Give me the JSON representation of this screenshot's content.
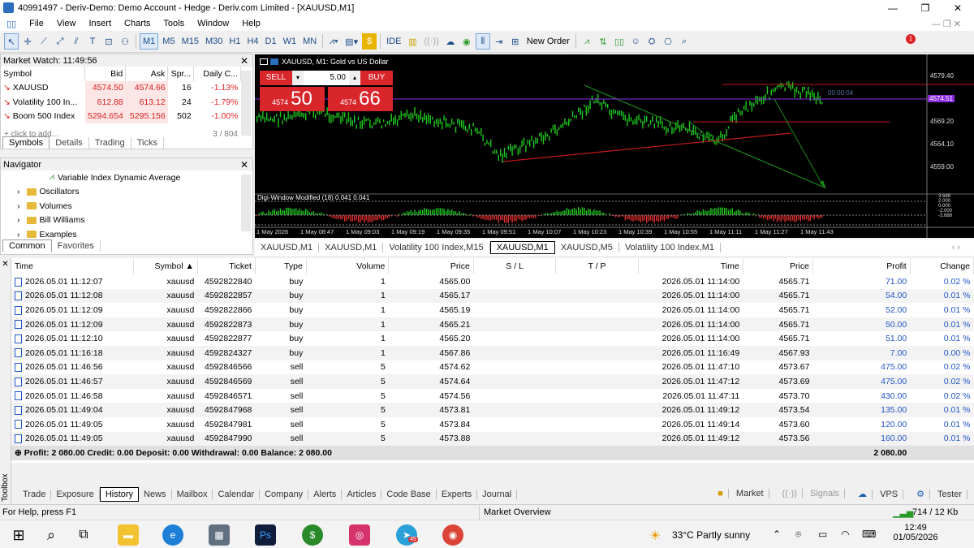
{
  "window": {
    "title": "40991497 - Deriv-Demo: Demo Account - Hedge - Deriv.com Limited - [XAUUSD,M1]"
  },
  "menu": [
    "File",
    "View",
    "Insert",
    "Charts",
    "Tools",
    "Window",
    "Help"
  ],
  "toolbar": {
    "timeframes": [
      "M1",
      "M5",
      "M15",
      "M30",
      "H1",
      "H4",
      "D1",
      "W1",
      "MN"
    ],
    "ide": "IDE",
    "new_order": "New Order",
    "notif_count": "1"
  },
  "market_watch": {
    "title": "Market Watch: 11:49:56",
    "headers": [
      "Symbol",
      "Bid",
      "Ask",
      "Spr...",
      "Daily C..."
    ],
    "rows": [
      {
        "symbol": "XAUUSD",
        "bid": "4574.50",
        "ask": "4574.66",
        "spread": "16",
        "change": "-1.13%"
      },
      {
        "symbol": "Volatility 100 In...",
        "bid": "612.88",
        "ask": "613.12",
        "spread": "24",
        "change": "-1.79%"
      },
      {
        "symbol": "Boom 500 Index",
        "bid": "5294.654",
        "ask": "5295.156",
        "spread": "502",
        "change": "-1.00%"
      }
    ],
    "add_text": "click to add...",
    "count": "3 / 804",
    "tabs": [
      "Symbols",
      "Details",
      "Trading",
      "Ticks"
    ]
  },
  "navigator": {
    "title": "Navigator",
    "items": [
      "Variable Index Dynamic Average",
      "Oscillators",
      "Volumes",
      "Bill Williams",
      "Examples"
    ],
    "tabs": [
      "Common",
      "Favorites"
    ]
  },
  "chart": {
    "header": "XAUUSD, M1:  Gold vs US Dollar",
    "sell": "SELL",
    "buy": "BUY",
    "lot": "5.00",
    "sell_small": "4574",
    "sell_big": "50",
    "buy_small": "4574",
    "buy_big": "66",
    "prices": [
      "4579.40",
      "4574.51",
      "4569.20",
      "4564.10",
      "4559.00"
    ],
    "timer": "00:00:04",
    "indicator": "Digi-Window Modified (18) 0.041 0.041",
    "ind_levels": [
      "3.688",
      "2.000",
      "0.000",
      "-2.000",
      "-3.688"
    ],
    "times": [
      "1 May 2026",
      "1 May 08:47",
      "1 May 09:03",
      "1 May 09:19",
      "1 May 09:35",
      "1 May 09:51",
      "1 May 10:07",
      "1 May 10:23",
      "1 May 10:39",
      "1 May 10:55",
      "1 May 11:11",
      "1 May 11:27",
      "1 May 11:43"
    ]
  },
  "chart_tabs": [
    "XAUUSD,M1",
    "XAUUSD,M1",
    "Volatility 100 Index,M15",
    "XAUUSD,M1",
    "XAUUSD,M5",
    "Volatility 100 Index,M1"
  ],
  "trades": {
    "headers": [
      "Time",
      "Symbol",
      "Ticket",
      "Type",
      "Volume",
      "Price",
      "S / L",
      "T / P",
      "Time",
      "Price",
      "Profit",
      "Change"
    ],
    "rows": [
      [
        "2026.05.01 11:12:07",
        "xauusd",
        "4592822840",
        "buy",
        "1",
        "4565.00",
        "",
        "",
        "2026.05.01 11:14:00",
        "4565.71",
        "71.00",
        "0.02 %"
      ],
      [
        "2026.05.01 11:12:08",
        "xauusd",
        "4592822857",
        "buy",
        "1",
        "4565.17",
        "",
        "",
        "2026.05.01 11:14:00",
        "4565.71",
        "54.00",
        "0.01 %"
      ],
      [
        "2026.05.01 11:12:09",
        "xauusd",
        "4592822866",
        "buy",
        "1",
        "4565.19",
        "",
        "",
        "2026.05.01 11:14:00",
        "4565.71",
        "52.00",
        "0.01 %"
      ],
      [
        "2026.05.01 11:12:09",
        "xauusd",
        "4592822873",
        "buy",
        "1",
        "4565.21",
        "",
        "",
        "2026.05.01 11:14:00",
        "4565.71",
        "50.00",
        "0.01 %"
      ],
      [
        "2026.05.01 11:12:10",
        "xauusd",
        "4592822877",
        "buy",
        "1",
        "4565.20",
        "",
        "",
        "2026.05.01 11:14:00",
        "4565.71",
        "51.00",
        "0.01 %"
      ],
      [
        "2026.05.01 11:16:18",
        "xauusd",
        "4592824327",
        "buy",
        "1",
        "4567.86",
        "",
        "",
        "2026.05.01 11:16:49",
        "4567.93",
        "7.00",
        "0.00 %"
      ],
      [
        "2026.05.01 11:46:56",
        "xauusd",
        "4592846566",
        "sell",
        "5",
        "4574.62",
        "",
        "",
        "2026.05.01 11:47:10",
        "4573.67",
        "475.00",
        "0.02 %"
      ],
      [
        "2026.05.01 11:46:57",
        "xauusd",
        "4592846569",
        "sell",
        "5",
        "4574.64",
        "",
        "",
        "2026.05.01 11:47:12",
        "4573.69",
        "475.00",
        "0.02 %"
      ],
      [
        "2026.05.01 11:46:58",
        "xauusd",
        "4592846571",
        "sell",
        "5",
        "4574.56",
        "",
        "",
        "2026.05.01 11:47:11",
        "4573.70",
        "430.00",
        "0.02 %"
      ],
      [
        "2026.05.01 11:49:04",
        "xauusd",
        "4592847968",
        "sell",
        "5",
        "4573.81",
        "",
        "",
        "2026.05.01 11:49:12",
        "4573.54",
        "135.00",
        "0.01 %"
      ],
      [
        "2026.05.01 11:49:05",
        "xauusd",
        "4592847981",
        "sell",
        "5",
        "4573.84",
        "",
        "",
        "2026.05.01 11:49:14",
        "4573.60",
        "120.00",
        "0.01 %"
      ],
      [
        "2026.05.01 11:49:05",
        "xauusd",
        "4592847990",
        "sell",
        "5",
        "4573.88",
        "",
        "",
        "2026.05.01 11:49:12",
        "4573.56",
        "160.00",
        "0.01 %"
      ]
    ],
    "summary": "Profit: 2 080.00  Credit: 0.00  Deposit: 0.00  Withdrawal: 0.00  Balance: 2 080.00",
    "summary_total": "2 080.00"
  },
  "toolbox": {
    "side": "Toolbox",
    "tabs": [
      "Trade",
      "Exposure",
      "History",
      "News",
      "Mailbox",
      "Calendar",
      "Company",
      "Alerts",
      "Articles",
      "Code Base",
      "Experts",
      "Journal"
    ],
    "right": [
      "Market",
      "Signals",
      "VPS",
      "Tester"
    ]
  },
  "status": {
    "help": "For Help, press F1",
    "overview": "Market Overview",
    "traffic": "714 / 12 Kb"
  },
  "taskbar": {
    "weather": "33°C  Partly sunny",
    "time": "12:49",
    "date": "01/05/2026",
    "telegram_badge": "45"
  }
}
